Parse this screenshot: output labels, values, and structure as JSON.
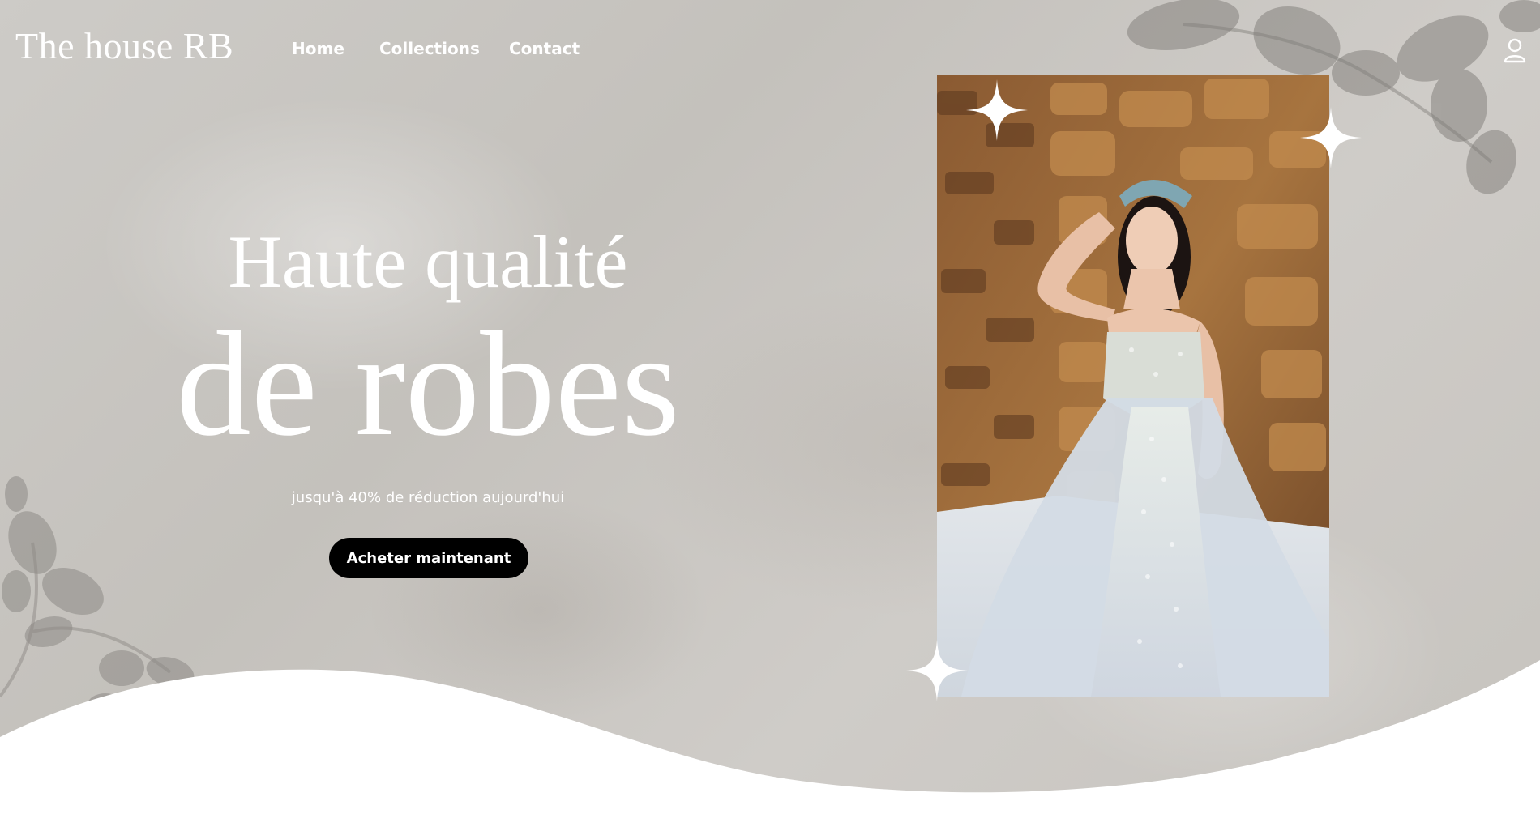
{
  "brand": {
    "logo_text": "The house RB"
  },
  "nav": {
    "links": [
      {
        "label": "Home"
      },
      {
        "label": "Collections"
      },
      {
        "label": "Contact"
      }
    ],
    "account_icon": "user-icon"
  },
  "hero": {
    "headline_line1": "Haute qualité",
    "headline_line2": "de robes",
    "promo_text": "jusqu'à 40% de réduction aujourd'hui",
    "cta_label": "Acheter maintenant",
    "photo_alt": "Mariée en robe blanche devant un mur de pierre",
    "sparkle_icon": "sparkle-icon"
  },
  "colors": {
    "text": "#ffffff",
    "cta_background": "#000000",
    "background_plaster": "#c9c6c1",
    "wave": "#ffffff"
  }
}
